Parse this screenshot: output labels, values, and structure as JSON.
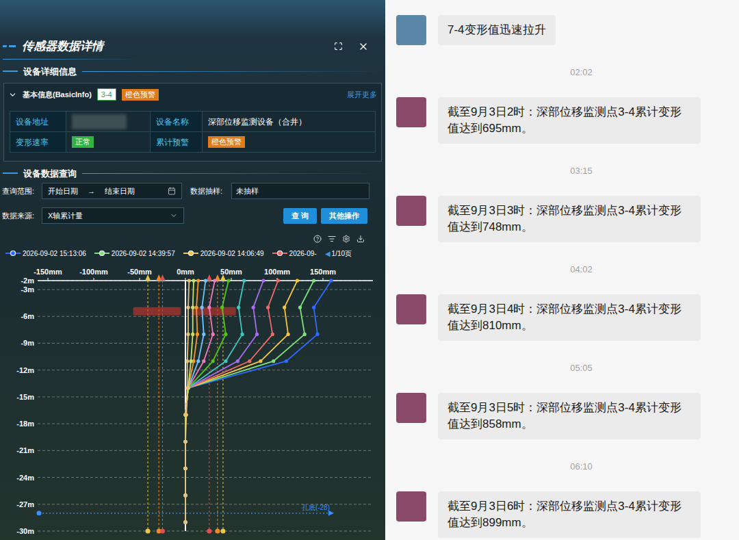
{
  "panel": {
    "title": "传感器数据详情"
  },
  "detail_section": {
    "title": "设备详细信息"
  },
  "basic_info": {
    "title": "基本信息(BasicInfo)",
    "expanded": true,
    "id_tag": "3-4",
    "warning_tag": "橙色预警",
    "warning_color": "#e07b1a",
    "more_link": "展开更多",
    "rows": [
      [
        {
          "label": "设备地址",
          "kind": "blurred",
          "value": ""
        },
        {
          "label": "设备名称",
          "kind": "text",
          "value": "深部位移监测设备（合井）"
        }
      ],
      [
        {
          "label": "变形速率",
          "kind": "badge",
          "value": "正常",
          "color": "#2fb344"
        },
        {
          "label": "累计预警",
          "kind": "badge",
          "value": "橙色预警",
          "color": "#e07b1a"
        }
      ]
    ]
  },
  "query": {
    "title": "设备数据查询",
    "range_label": "查询范围:",
    "start_placeholder": "开始日期",
    "arrow": "→",
    "end_placeholder": "结束日期",
    "sampling_label": "数据抽样:",
    "sampling_value": "未抽样",
    "source_label": "数据来源:",
    "source_value": "X轴累计量",
    "buttons": [
      "查 询",
      "其他操作"
    ]
  },
  "chart": {
    "legend": [
      {
        "label": "2026-09-02 15:13:06",
        "color": "#2f6bff"
      },
      {
        "label": "2026-09-02 14:39:57",
        "color": "#7ee07e"
      },
      {
        "label": "2026-09-02 14:06:49",
        "color": "#f5c542"
      },
      {
        "label": "2026-09-",
        "color": "#f06a6a"
      }
    ],
    "page_prev": "◀",
    "page": "1/10页",
    "x_ticks": [
      {
        "label": "-150mm",
        "value": -150
      },
      {
        "label": "-100mm",
        "value": -100
      },
      {
        "label": "-50mm",
        "value": -50
      },
      {
        "label": "0mm",
        "value": 0
      },
      {
        "label": "50mm",
        "value": 50
      },
      {
        "label": "100mm",
        "value": 100
      },
      {
        "label": "150mm",
        "value": 150
      }
    ],
    "y_ticks": [
      {
        "label": "-2m",
        "value": -2
      },
      {
        "label": "-3m",
        "value": -3
      },
      {
        "label": "-6m",
        "value": -6
      },
      {
        "label": "-9m",
        "value": -9
      },
      {
        "label": "-12m",
        "value": -12
      },
      {
        "label": "-15m",
        "value": -15
      },
      {
        "label": "-18m",
        "value": -18
      },
      {
        "label": "-21m",
        "value": -21
      },
      {
        "label": "-24m",
        "value": -24
      },
      {
        "label": "-27m",
        "value": -27
      },
      {
        "label": "-30m",
        "value": -30
      }
    ],
    "depths": [
      -2,
      -5,
      -8,
      -11,
      -14,
      -17,
      -20,
      -23,
      -26,
      -29
    ],
    "series": [
      {
        "color": "#2f6bff",
        "values": [
          159,
          140,
          144,
          110,
          3,
          0,
          0,
          0,
          0,
          0
        ]
      },
      {
        "color": "#7ee07e",
        "values": [
          140,
          125,
          130,
          96,
          3,
          0,
          0,
          0,
          0,
          0
        ]
      },
      {
        "color": "#f5c542",
        "values": [
          122,
          108,
          112,
          82,
          3,
          0,
          0,
          0,
          0,
          0
        ]
      },
      {
        "color": "#f06a6a",
        "values": [
          101,
          90,
          95,
          70,
          3,
          0,
          0,
          0,
          0,
          0
        ]
      },
      {
        "color": "#a86cf0",
        "values": [
          85,
          74,
          78,
          57,
          3,
          0,
          0,
          0,
          0,
          0
        ]
      },
      {
        "color": "#3fc8c0",
        "values": [
          64,
          58,
          62,
          44,
          3,
          0,
          0,
          0,
          0,
          0
        ]
      },
      {
        "color": "#52c41a",
        "values": [
          47,
          40,
          44,
          30,
          3,
          0,
          0,
          0,
          0,
          0
        ]
      },
      {
        "color": "#f07ac0",
        "values": [
          32,
          26,
          30,
          20,
          3,
          0,
          0,
          0,
          0,
          0
        ]
      },
      {
        "color": "#6fc3ff",
        "values": [
          22,
          18,
          20,
          14,
          3,
          0,
          0,
          0,
          0,
          0
        ]
      },
      {
        "color": "#f59a23",
        "values": [
          14,
          12,
          13,
          9,
          3,
          0,
          0,
          0,
          0,
          0
        ]
      },
      {
        "color": "#c8e06a",
        "values": [
          9,
          8,
          8,
          6,
          3,
          0,
          0,
          0,
          0,
          0
        ]
      },
      {
        "color": "#e8c080",
        "values": [
          4,
          3,
          3,
          2,
          2,
          1,
          0,
          0,
          0,
          0
        ]
      }
    ],
    "thresholds": [
      {
        "value": -41,
        "color": "#e6c84a"
      },
      {
        "value": -29,
        "color": "#f08a24"
      },
      {
        "value": -25,
        "color": "#e05050"
      },
      {
        "value": 26,
        "color": "#e05050"
      },
      {
        "value": 35,
        "color": "#f08a24"
      },
      {
        "value": 41,
        "color": "#e6c84a"
      }
    ],
    "annotations": [
      {
        "from": -57,
        "to": -5,
        "depth": -5.5,
        "color": "#d0342c"
      },
      {
        "from": 7,
        "to": 55,
        "depth": -5.5,
        "color": "#d0342c"
      }
    ],
    "bottom_marker": {
      "label": "孔底(-28)",
      "depth": -28,
      "color": "#3b8fff"
    }
  },
  "chat": {
    "items": [
      {
        "kind": "message",
        "avatar_color": "#5a86a8",
        "text": "7-4变形值迅速拉升"
      },
      {
        "kind": "time",
        "text": "02:02"
      },
      {
        "kind": "message",
        "avatar_color": "#8a4a6a",
        "text": "截至9月3日2时：深部位移监测点3-4累计变形值达到695mm。"
      },
      {
        "kind": "time",
        "text": "03:15"
      },
      {
        "kind": "message",
        "avatar_color": "#8a4a6a",
        "text": "截至9月3日3时：深部位移监测点3-4累计变形值达到748mm。"
      },
      {
        "kind": "time",
        "text": "04:02"
      },
      {
        "kind": "message",
        "avatar_color": "#8a4a6a",
        "text": "截至9月3日4时：深部位移监测点3-4累计变形值达到810mm。"
      },
      {
        "kind": "time",
        "text": "05:05"
      },
      {
        "kind": "message",
        "avatar_color": "#8a4a6a",
        "text": "截至9月3日5时：深部位移监测点3-4累计变形值达到858mm。"
      },
      {
        "kind": "time",
        "text": "06:10"
      },
      {
        "kind": "message",
        "avatar_color": "#8a4a6a",
        "text": "截至9月3日6时：深部位移监测点3-4累计变形值达到899mm。"
      }
    ]
  }
}
